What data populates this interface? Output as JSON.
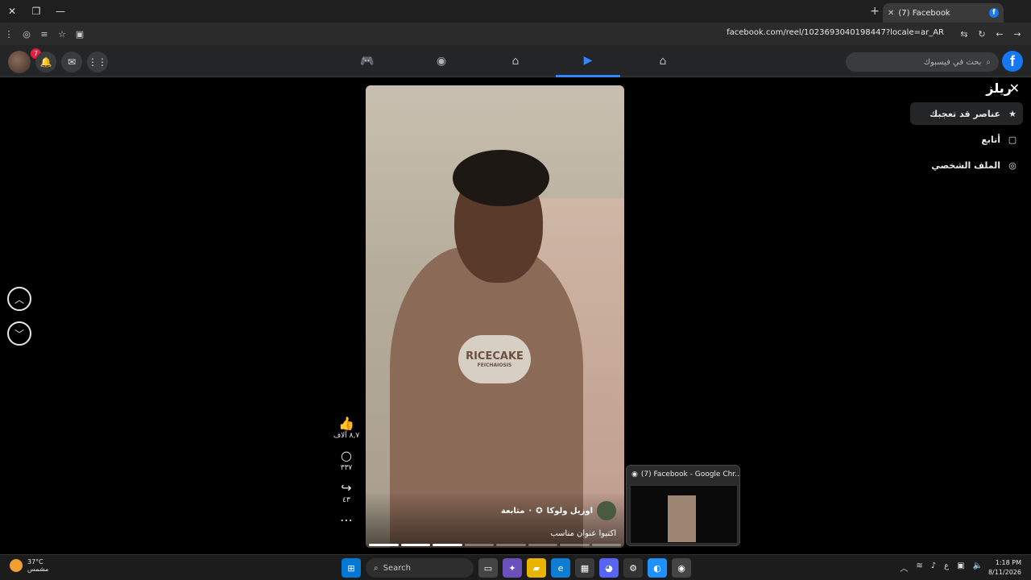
{
  "browser": {
    "tab_title": "(7) Facebook",
    "url": "facebook.com/reel/1023693040198447?locale=ar_AR"
  },
  "fb_nav": {
    "notification_count": "7",
    "search_placeholder": "بحث في فيسبوك",
    "logo_letter": "f"
  },
  "sidebar": {
    "title": "ريلز",
    "items": [
      {
        "label": "عناصر قد تعجبك",
        "icon": "star-icon"
      },
      {
        "label": "أتابع",
        "icon": "following-icon"
      },
      {
        "label": "الملف الشخصي",
        "icon": "profile-icon"
      }
    ]
  },
  "reel": {
    "author": "اوزيل ولوكا",
    "follow_label": "متابعة",
    "caption": "اكتبوا عنوان مناسب",
    "hoodie_text": "RICECAKE",
    "hoodie_subtext": "FEICHAIOSIS",
    "likes": "٨,٧ آلاف",
    "comments": "٣٣٧",
    "shares": "٤٣"
  },
  "taskbar_preview": {
    "title": "(7) Facebook - Google Chr..."
  },
  "taskbar": {
    "temp": "37°C",
    "weather": "مشمس",
    "search_label": "Search",
    "time": "1:18 PM",
    "date": "8/11/2026",
    "tray_lang": "ع"
  }
}
